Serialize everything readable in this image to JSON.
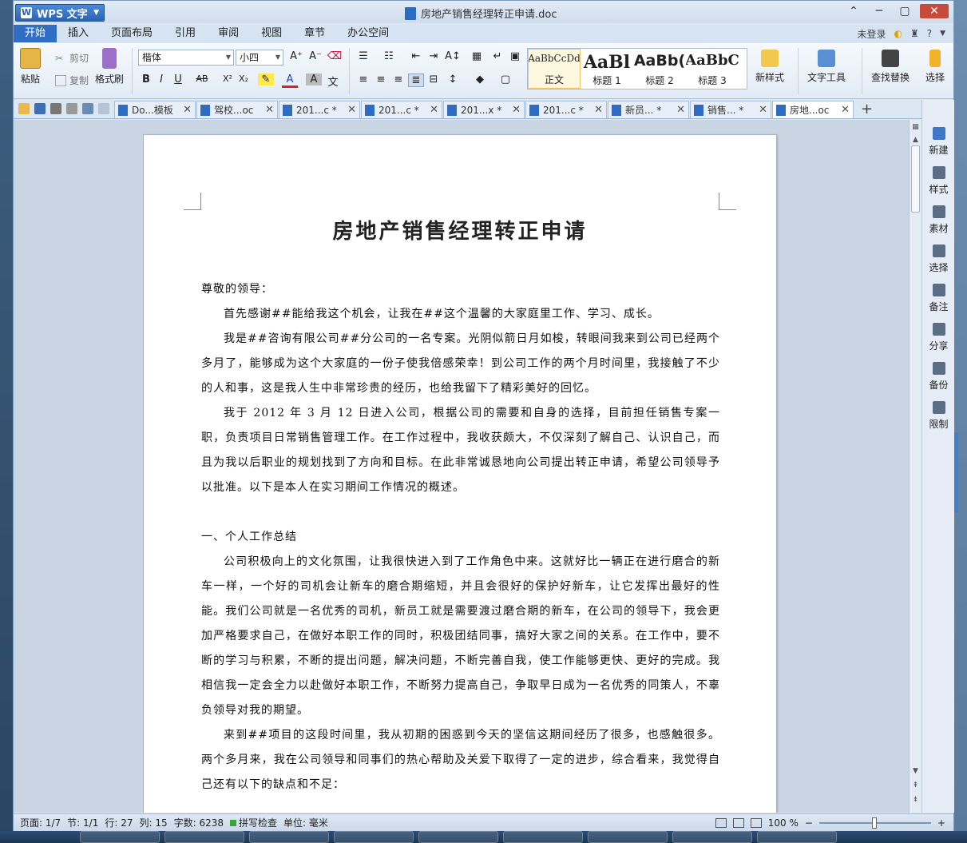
{
  "app": {
    "name": "WPS 文字",
    "document_title": "房地产销售经理转正申请.doc"
  },
  "menu": {
    "tabs": [
      "开始",
      "插入",
      "页面布局",
      "引用",
      "审阅",
      "视图",
      "章节",
      "办公空间"
    ],
    "active": "开始",
    "login": "未登录",
    "help": "?"
  },
  "ribbon": {
    "paste": "粘贴",
    "cut": "剪切",
    "copy": "复制",
    "format_painter": "格式刷",
    "font_name": "楷体",
    "font_size": "小四",
    "styles": [
      {
        "preview": "AaBbCcDd",
        "label": "正文"
      },
      {
        "preview": "AaBl",
        "label": "标题 1"
      },
      {
        "preview": "AaBb(",
        "label": "标题 2"
      },
      {
        "preview": "AaBbC",
        "label": "标题 3"
      }
    ],
    "new_style": "新样式",
    "text_tools": "文字工具",
    "find_replace": "查找替换",
    "select": "选择"
  },
  "doc_tabs": [
    {
      "label": "Do...模板",
      "active": false
    },
    {
      "label": "驾校...oc",
      "active": false
    },
    {
      "label": "201...c *",
      "active": false
    },
    {
      "label": "201...c *",
      "active": false
    },
    {
      "label": "201...x *",
      "active": false
    },
    {
      "label": "201...c *",
      "active": false
    },
    {
      "label": "新员... *",
      "active": false
    },
    {
      "label": "销售... *",
      "active": false
    },
    {
      "label": "房地...oc",
      "active": true
    }
  ],
  "taskpane": [
    "新建",
    "样式",
    "素材",
    "选择",
    "备注",
    "分享",
    "备份",
    "限制"
  ],
  "document": {
    "heading": "房地产销售经理转正申请",
    "paragraphs": [
      {
        "text": "尊敬的领导：",
        "indent": false
      },
      {
        "text": "首先感谢##能给我这个机会，让我在##这个温馨的大家庭里工作、学习、成长。",
        "indent": true
      },
      {
        "text": "我是##咨询有限公司##分公司的一名专案。光阴似箭日月如梭，转眼间我来到公司已经两个多月了，能够成为这个大家庭的一份子使我倍感荣幸！到公司工作的两个月时间里，我接触了不少的人和事，这是我人生中非常珍贵的经历，也给我留下了精彩美好的回忆。",
        "indent": true
      },
      {
        "text": "我于 2012 年 3 月 12 日进入公司，根据公司的需要和自身的选择，目前担任销售专案一职，负责项目日常销售管理工作。在工作过程中，我收获颇大，不仅深刻了解自己、认识自己，而且为我以后职业的规划找到了方向和目标。在此非常诚恳地向公司提出转正申请，希望公司领导予以批准。以下是本人在实习期间工作情况的概述。",
        "indent": true
      },
      {
        "text": "",
        "indent": false
      },
      {
        "text": "一、个人工作总结",
        "indent": false
      },
      {
        "text": "公司积极向上的文化氛围，让我很快进入到了工作角色中来。这就好比一辆正在进行磨合的新车一样，一个好的司机会让新车的磨合期缩短，并且会很好的保护好新车，让它发挥出最好的性能。我们公司就是一名优秀的司机，新员工就是需要渡过磨合期的新车，在公司的领导下，我会更加严格要求自己，在做好本职工作的同时，积极团结同事，搞好大家之间的关系。在工作中，要不断的学习与积累，不断的提出问题，解决问题，不断完善自我，使工作能够更快、更好的完成。我相信我一定会全力以赴做好本职工作，不断努力提高自己，争取早日成为一名优秀的同策人，不辜负领导对我的期望。",
        "indent": true
      },
      {
        "text": "来到##项目的这段时间里，我从初期的困惑到今天的坚信这期间经历了很多，也感触很多。两个多月来，我在公司领导和同事们的热心帮助及关爱下取得了一定的进步，综合看来，我觉得自己还有以下的缺点和不足：",
        "indent": true
      }
    ]
  },
  "status": {
    "page": "页面: 1/7",
    "section": "节: 1/1",
    "line": "行: 27",
    "column": "列: 15",
    "word_count": "字数: 6238",
    "spell_check": "拼写检查",
    "unit": "单位: 毫米",
    "zoom": "100 %",
    "zoom_level": 1.0
  }
}
